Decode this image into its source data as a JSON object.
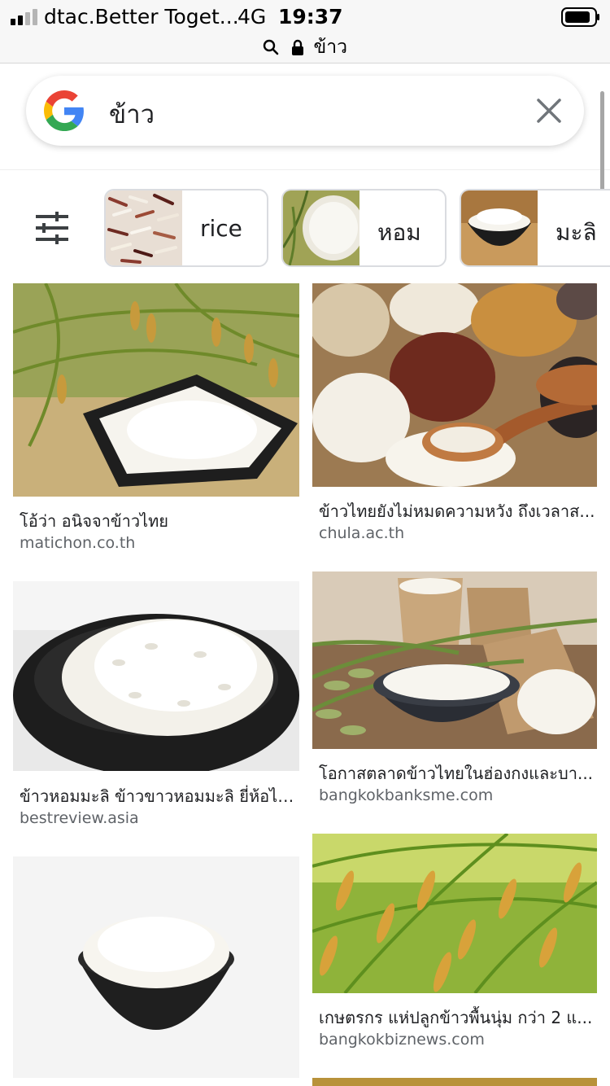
{
  "status_bar": {
    "carrier": "dtac.Better Toget...",
    "network": "4G",
    "time": "19:37",
    "url": "ข้าว"
  },
  "search": {
    "query": "ข้าว"
  },
  "chips": [
    {
      "label": "rice"
    },
    {
      "label": "หอม"
    },
    {
      "label": "มะลิ"
    }
  ],
  "results": [
    {
      "title": "โอ้ว่า อนิจจาข้าวไทย",
      "source": "matichon.co.th"
    },
    {
      "title": "ข้าวไทยยังไม่หมดความหวัง ถึงเวลาส...",
      "source": "chula.ac.th"
    },
    {
      "title": "ข้าวหอมมะลิ ข้าวขาวหอมมะลิ ยี่ห้อไห...",
      "source": "bestreview.asia"
    },
    {
      "title": "โอกาสตลาดข้าวไทยในฮ่องกงและบา...",
      "source": "bangkokbanksme.com"
    },
    {
      "title": "เกษตรกร แห่ปลูกข้าวพื้นนุ่ม กว่า 2 แ...",
      "source": "bangkokbiznews.com"
    }
  ],
  "colors": {
    "google_blue": "#4285F4",
    "google_red": "#EA4335",
    "google_yellow": "#FBBC05",
    "google_green": "#34A853"
  }
}
